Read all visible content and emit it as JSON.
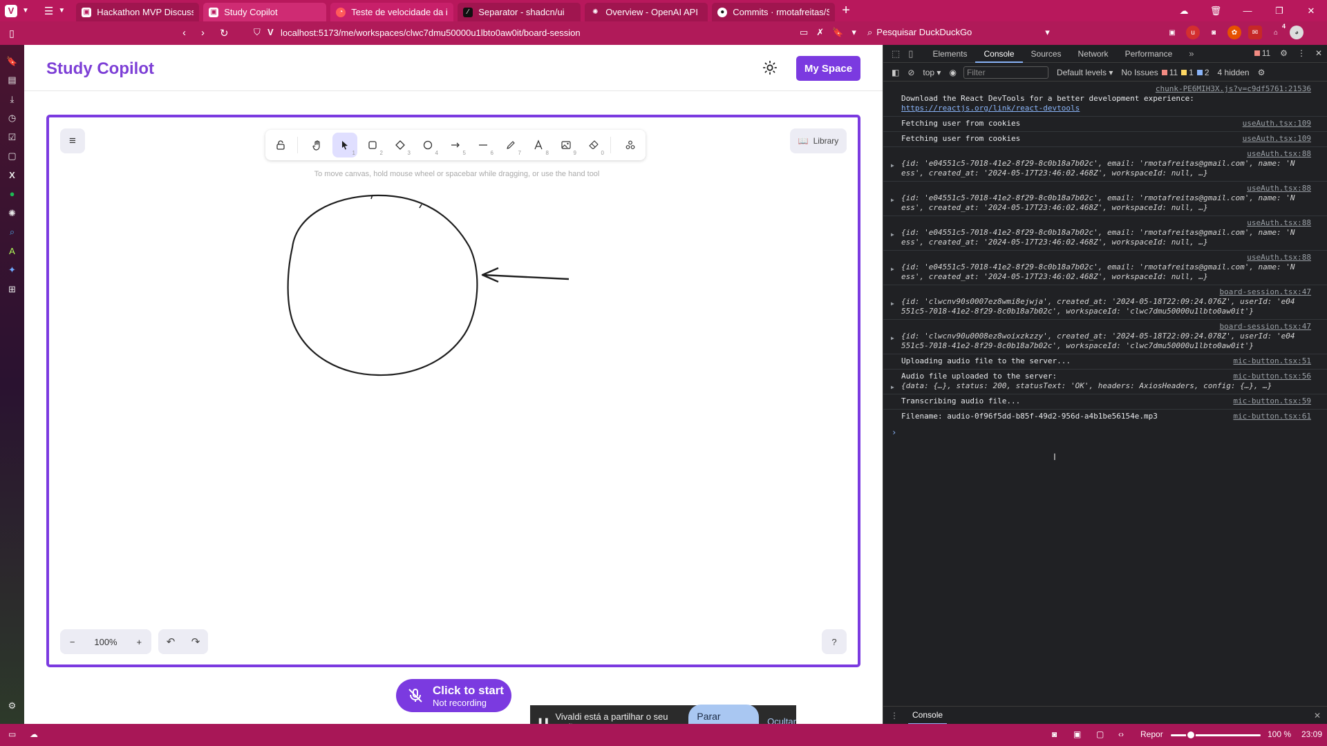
{
  "browser": {
    "tabs": [
      {
        "label": "Hackathon MVP Discussion",
        "fav_color": "#ffffff"
      },
      {
        "label": "Study Copilot",
        "fav_color": "#ffffff"
      },
      {
        "label": "Teste de velocidade da inte",
        "fav_color": "#ff5a5a"
      },
      {
        "label": "Separator - shadcn/ui",
        "fav_color": "#111111"
      },
      {
        "label": "Overview - OpenAI API",
        "fav_color": "#ffffff"
      },
      {
        "label": "Commits · rmotafreitas/Stu",
        "fav_color": "#ffffff"
      }
    ],
    "active_tab": 1,
    "url": "localhost:5173/me/workspaces/clwc7dmu50000u1lbto0aw0it/board-session",
    "search_placeholder": "Pesquisar DuckDuckGo",
    "notification_count": "4"
  },
  "app": {
    "title": "Study Copilot",
    "my_space_label": "My Space",
    "canvas_hint": "To move canvas, hold mouse wheel or spacebar while dragging, or use the hand tool",
    "library_label": "Library",
    "zoom_level": "100%",
    "record": {
      "title": "Click to start",
      "subtitle": "Not recording"
    },
    "tools": [
      {
        "name": "lock",
        "key": ""
      },
      {
        "name": "hand",
        "key": ""
      },
      {
        "name": "selection",
        "key": "1"
      },
      {
        "name": "rectangle",
        "key": "2"
      },
      {
        "name": "diamond",
        "key": "3"
      },
      {
        "name": "ellipse",
        "key": "4"
      },
      {
        "name": "arrow",
        "key": "5"
      },
      {
        "name": "line",
        "key": "6"
      },
      {
        "name": "draw",
        "key": "7"
      },
      {
        "name": "text",
        "key": "8"
      },
      {
        "name": "image",
        "key": "9"
      },
      {
        "name": "eraser",
        "key": "0"
      },
      {
        "name": "extra-tools",
        "key": ""
      }
    ],
    "selected_tool": "selection"
  },
  "share": {
    "message": "Vivaldi está a partilhar o seu ecrã.",
    "stop_label": "Parar partilha",
    "hide_label": "Ocultar"
  },
  "devtools": {
    "tabs": [
      "Elements",
      "Console",
      "Sources",
      "Network",
      "Performance"
    ],
    "active_tab": "Console",
    "error_count": "11",
    "context": "top",
    "filter_placeholder": "Filter",
    "levels_label": "Default levels",
    "issues_label": "No Issues",
    "issues": {
      "errors": "11",
      "warnings": "1",
      "info": "2"
    },
    "hidden_label": "4 hidden",
    "drawer_label": "Console",
    "log": [
      {
        "src": "chunk-PE6MIH3X.js?v=c9df5761:21536",
        "text": "Download the React DevTools for a better development experience:",
        "link": "https://reactjs.org/link/react-devtools"
      },
      {
        "src": "useAuth.tsx:109",
        "text": "Fetching user from cookies"
      },
      {
        "src": "useAuth.tsx:109",
        "text": "Fetching user from cookies"
      },
      {
        "src": "useAuth.tsx:88",
        "object": "{id: 'e04551c5-7018-41e2-8f29-8c0b18a7b02c', email: 'rmotafreitas@gmail.com', name: 'N",
        "object2": "ess', created_at: '2024-05-17T23:46:02.468Z', workspaceId: null, …}"
      },
      {
        "src": "useAuth.tsx:88",
        "object": "{id: 'e04551c5-7018-41e2-8f29-8c0b18a7b02c', email: 'rmotafreitas@gmail.com', name: 'N",
        "object2": "ess', created_at: '2024-05-17T23:46:02.468Z', workspaceId: null, …}"
      },
      {
        "src": "useAuth.tsx:88",
        "object": "{id: 'e04551c5-7018-41e2-8f29-8c0b18a7b02c', email: 'rmotafreitas@gmail.com', name: 'N",
        "object2": "ess', created_at: '2024-05-17T23:46:02.468Z', workspaceId: null, …}"
      },
      {
        "src": "useAuth.tsx:88",
        "object": "{id: 'e04551c5-7018-41e2-8f29-8c0b18a7b02c', email: 'rmotafreitas@gmail.com', name: 'N",
        "object2": "ess', created_at: '2024-05-17T23:46:02.468Z', workspaceId: null, …}"
      },
      {
        "src": "board-session.tsx:47",
        "object": "{id: 'clwcnv90s0007ez8wmi8ejwja', created_at: '2024-05-18T22:09:24.076Z', userId: 'e04",
        "object2": "551c5-7018-41e2-8f29-8c0b18a7b02c', workspaceId: 'clwc7dmu50000u1lbto0aw0it'}"
      },
      {
        "src": "board-session.tsx:47",
        "object": "{id: 'clwcnv90u0008ez8woixzkzzy', created_at: '2024-05-18T22:09:24.078Z', userId: 'e04",
        "object2": "551c5-7018-41e2-8f29-8c0b18a7b02c', workspaceId: 'clwc7dmu50000u1lbto0aw0it'}"
      },
      {
        "src": "mic-button.tsx:51",
        "text": "Uploading audio file to the server..."
      },
      {
        "src": "mic-button.tsx:56",
        "text": "Audio file uploaded to the server:",
        "object": "{data: {…}, status: 200, statusText: 'OK', headers: AxiosHeaders, config: {…}, …}"
      },
      {
        "src": "mic-button.tsx:59",
        "text": "Transcribing audio file..."
      },
      {
        "src": "mic-button.tsx:61",
        "text": "Filename: audio-0f96f5dd-b85f-49d2-956d-a4b1be56154e.mp3"
      }
    ]
  },
  "statusbar": {
    "reset_label": "Repor",
    "zoom": "100 %",
    "time": "23:09"
  }
}
